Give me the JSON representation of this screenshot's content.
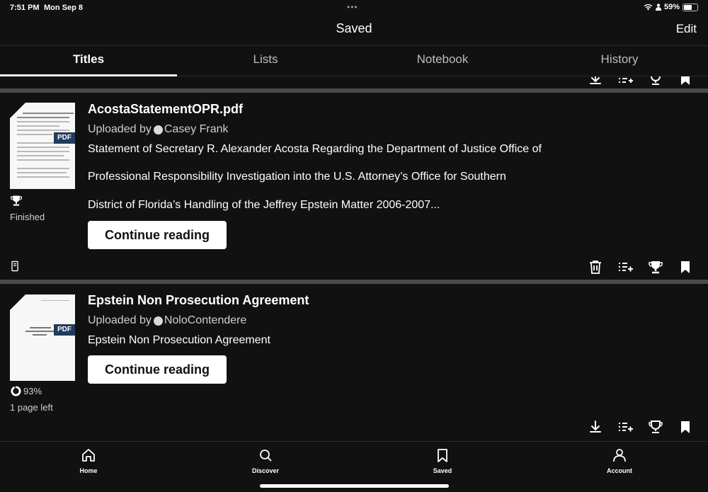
{
  "status_bar": {
    "time": "7:51 PM",
    "date": "Mon Sep 8",
    "battery": "59%",
    "battery_level": 0.59
  },
  "header": {
    "title": "Saved",
    "edit_label": "Edit"
  },
  "tabs": [
    {
      "label": "Titles",
      "active": true
    },
    {
      "label": "Lists",
      "active": false
    },
    {
      "label": "Notebook",
      "active": false
    },
    {
      "label": "History",
      "active": false
    }
  ],
  "documents": [
    {
      "title": "AcostaStatementOPR.pdf",
      "uploaded_by_label": "Uploaded by",
      "uploader": "Casey Frank",
      "description_lines": [
        "Statement of Secretary R. Alexander Acosta Regarding the Department of Justice Office of",
        " Professional Responsibility Investigation into the U.S. Attorney’s Office for Southern",
        " District of Florida’s Handling of the Jeffrey Epstein Matter 2006-2007..."
      ],
      "file_type": "PDF",
      "status": "Finished",
      "status_icon": "trophy-icon",
      "button_label": "Continue reading",
      "actions": [
        "trash-icon",
        "add-to-list-icon",
        "trophy-icon",
        "bookmark-icon"
      ],
      "extra_icon": "device-icon"
    },
    {
      "title": "Epstein Non Prosecution Agreement",
      "uploaded_by_label": "Uploaded by",
      "uploader": "NoloContendere",
      "description_lines": [
        "Epstein Non Prosecution Agreement"
      ],
      "file_type": "PDF",
      "progress": "93%",
      "progress_value": 0.93,
      "pages_left": "1 page left",
      "button_label": "Continue reading",
      "actions": [
        "download-icon",
        "add-to-list-icon",
        "trophy-icon",
        "bookmark-icon"
      ]
    }
  ],
  "bottom_nav": [
    {
      "label": "Home",
      "icon": "home-icon"
    },
    {
      "label": "Discover",
      "icon": "search-icon"
    },
    {
      "label": "Saved",
      "icon": "bookmark-icon"
    },
    {
      "label": "Account",
      "icon": "person-icon"
    }
  ]
}
